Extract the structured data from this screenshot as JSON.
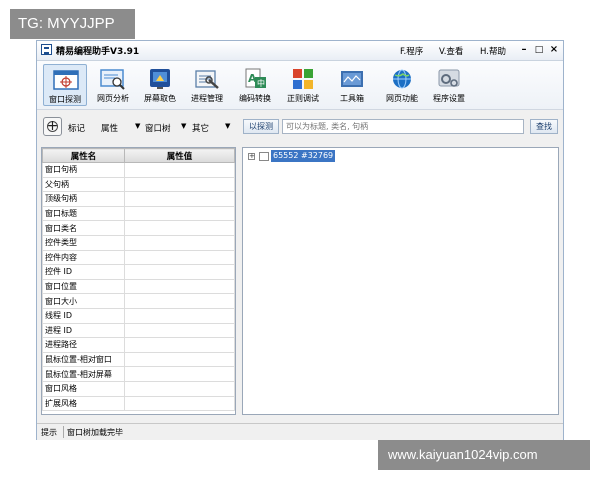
{
  "watermark_top": "TG: MYYJJPP",
  "watermark_bottom": "www.kaiyuan1024vip.com",
  "window": {
    "title": "精易编程助手V3.91",
    "menus": [
      "F.程序",
      "V.查看",
      "H.帮助"
    ],
    "controls": [
      "–",
      "□",
      "×"
    ]
  },
  "toolbar": {
    "buttons": [
      {
        "label": "窗口探测",
        "icon": "window-probe-icon",
        "color": "#2f6fb8"
      },
      {
        "label": "网页分析",
        "icon": "web-analysis-icon",
        "color": "#4a8bd0"
      },
      {
        "label": "屏幕取色",
        "icon": "color-picker-icon",
        "color": "#1f4f9a"
      },
      {
        "label": "进程管理",
        "icon": "process-manager-icon",
        "color": "#5a7fa8"
      },
      {
        "label": "编码转换",
        "icon": "encoding-convert-icon",
        "color": "#2e8b57"
      },
      {
        "label": "正则调试",
        "icon": "regex-debug-icon",
        "color": "#d9442b"
      },
      {
        "label": "工具箱",
        "icon": "toolbox-icon",
        "color": "#3c6fb0"
      },
      {
        "label": "网页功能",
        "icon": "globe-icon",
        "color": "#1c6fc4"
      },
      {
        "label": "程序设置",
        "icon": "settings-icon",
        "color": "#8a97a8"
      }
    ]
  },
  "filter": {
    "label": "标记",
    "dropdowns": [
      "属性",
      "窗口树",
      "其它"
    ],
    "probe_button": "以探测",
    "search_placeholder": "可以为标题, 类名, 句柄",
    "find_button": "查找"
  },
  "properties": {
    "headers": [
      "属性名",
      "属性值"
    ],
    "rows": [
      {
        "name": "窗口句柄",
        "value": ""
      },
      {
        "name": "父句柄",
        "value": ""
      },
      {
        "name": "顶级句柄",
        "value": ""
      },
      {
        "name": "窗口标题",
        "value": ""
      },
      {
        "name": "窗口类名",
        "value": ""
      },
      {
        "name": "控件类型",
        "value": ""
      },
      {
        "name": "控件内容",
        "value": ""
      },
      {
        "name": "控件 ID",
        "value": ""
      },
      {
        "name": "窗口位置",
        "value": ""
      },
      {
        "name": "窗口大小",
        "value": ""
      },
      {
        "name": "线程 ID",
        "value": ""
      },
      {
        "name": "进程 ID",
        "value": ""
      },
      {
        "name": "进程路径",
        "value": ""
      },
      {
        "name": "鼠标位置-相对窗口",
        "value": ""
      },
      {
        "name": "鼠标位置-相对屏幕",
        "value": ""
      },
      {
        "name": "窗口风格",
        "value": ""
      },
      {
        "name": "扩展风格",
        "value": ""
      }
    ]
  },
  "tree": {
    "root": {
      "expander": "+",
      "label": "65552 #32769"
    }
  },
  "status": {
    "left": "提示",
    "message": "窗口树加载完毕"
  }
}
